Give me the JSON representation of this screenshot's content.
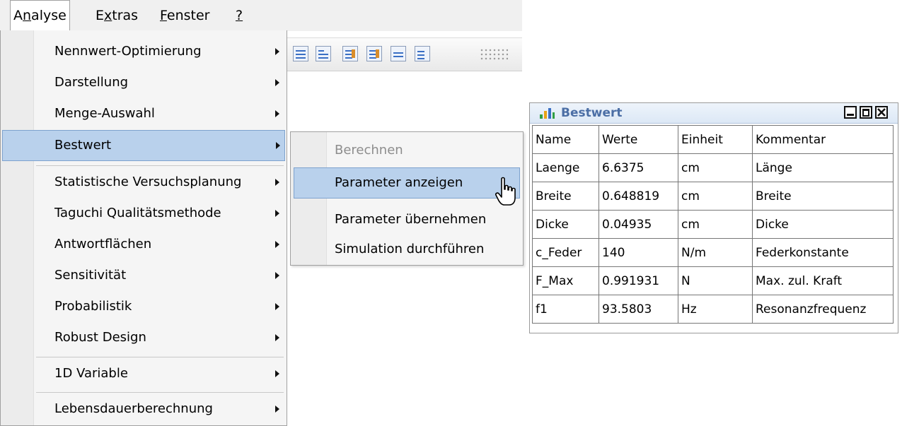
{
  "menubar": {
    "items": [
      {
        "label": "Analyse",
        "mnemonic": "n",
        "active": true
      },
      {
        "label": "Extras",
        "mnemonic": "x",
        "active": false
      },
      {
        "label": "Fenster",
        "mnemonic": "F",
        "active": false
      },
      {
        "label": "?",
        "mnemonic": "?",
        "active": false
      }
    ]
  },
  "dropdown": {
    "items": [
      {
        "label": "Nennwert-Optimierung",
        "submenu": true
      },
      {
        "label": "Darstellung",
        "submenu": true
      },
      {
        "label": "Menge-Auswahl",
        "submenu": true
      },
      {
        "label": "Bestwert",
        "submenu": true,
        "highlighted": true
      },
      {
        "label": "Statistische Versuchsplanung",
        "submenu": true
      },
      {
        "label": "Taguchi Qualitätsmethode",
        "submenu": true
      },
      {
        "label": "Antwortflächen",
        "submenu": true
      },
      {
        "label": "Sensitivität",
        "submenu": true
      },
      {
        "label": "Probabilistik",
        "submenu": true
      },
      {
        "label": "Robust Design",
        "submenu": true
      },
      {
        "label": "1D Variable",
        "submenu": true
      },
      {
        "label": "Lebensdauerberechnung",
        "submenu": true
      }
    ]
  },
  "submenu": {
    "items": [
      {
        "label": "Berechnen",
        "disabled": true
      },
      {
        "label": "Parameter anzeigen",
        "highlighted": true
      },
      {
        "label": "Parameter übernehmen"
      },
      {
        "label": "Simulation durchführen"
      }
    ]
  },
  "window": {
    "title": "Bestwert",
    "icon": "bar-chart-icon",
    "controls": [
      "minimize-icon",
      "maximize-icon",
      "close-icon"
    ],
    "columns": [
      "Name",
      "Werte",
      "Einheit",
      "Kommentar"
    ],
    "rows": [
      [
        "Laenge",
        "6.6375",
        "cm",
        "Länge"
      ],
      [
        "Breite",
        "0.648819",
        "cm",
        "Breite"
      ],
      [
        "Dicke",
        "0.04935",
        "cm",
        "Dicke"
      ],
      [
        "c_Feder",
        "140",
        "N/m",
        "Federkonstante"
      ],
      [
        "F_Max",
        "0.991931",
        "N",
        "Max. zul. Kraft"
      ],
      [
        "f1",
        "93.5803",
        "Hz",
        "Resonanzfrequenz"
      ]
    ]
  },
  "colors": {
    "highlight": "#b9d1ec",
    "highlight_border": "#7da2ce",
    "title_text": "#4b6ea5",
    "disabled_text": "#8d8d8d"
  }
}
